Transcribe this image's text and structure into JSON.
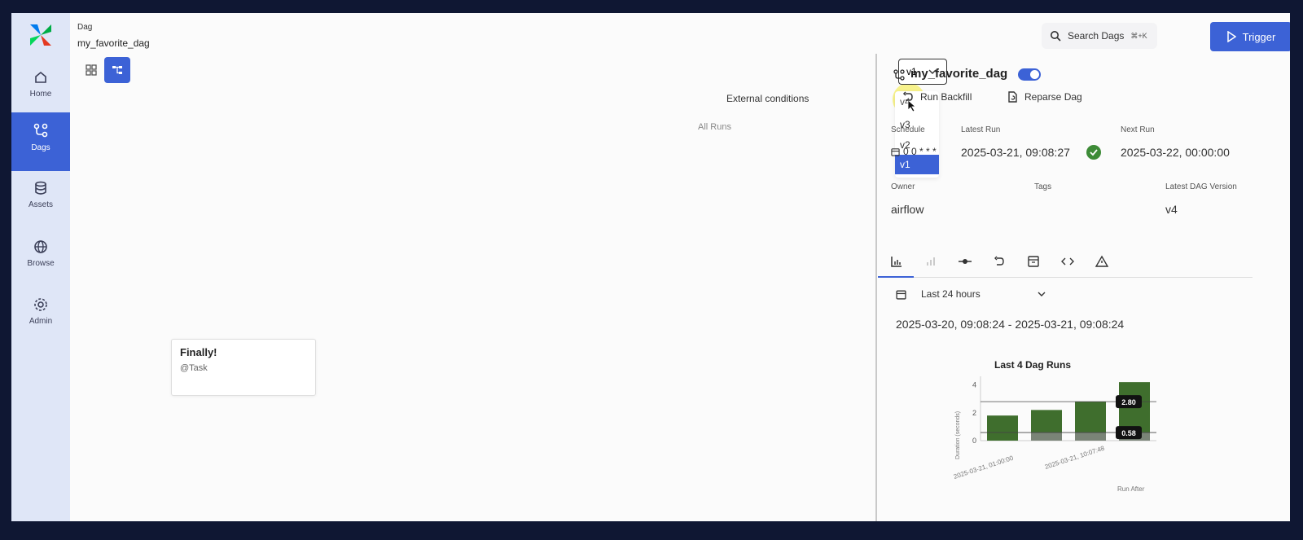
{
  "header": {
    "dag_label": "Dag",
    "dag_name": "my_favorite_dag",
    "search_label": "Search Dags",
    "search_shortcut": "⌘+K",
    "trigger_label": "Trigger"
  },
  "sidebar": {
    "items": [
      {
        "label": "Home",
        "icon": "home-icon",
        "active": false
      },
      {
        "label": "Dags",
        "icon": "dags-icon",
        "active": true
      },
      {
        "label": "Assets",
        "icon": "assets-icon",
        "active": false
      },
      {
        "label": "Browse",
        "icon": "browse-icon",
        "active": false
      },
      {
        "label": "Admin",
        "icon": "admin-icon",
        "active": false
      }
    ]
  },
  "graph": {
    "external_conditions": "External conditions",
    "all_runs": "All Runs",
    "version_selected": "v1",
    "version_options": [
      "v4",
      "v3",
      "v2",
      "v1"
    ],
    "node": {
      "title": "Finally!",
      "subtitle": "@Task"
    }
  },
  "details": {
    "dag_name": "my_favorite_dag",
    "run_backfill": "Run Backfill",
    "reparse_dag": "Reparse Dag",
    "schedule_label": "Schedule",
    "schedule_value": "0 0 * * *",
    "latest_run_label": "Latest Run",
    "latest_run_value": "2025-03-21, 09:08:27",
    "next_run_label": "Next Run",
    "next_run_value": "2025-03-22, 00:00:00",
    "owner_label": "Owner",
    "owner_value": "airflow",
    "tags_label": "Tags",
    "latest_version_label": "Latest DAG Version",
    "latest_version_value": "v4",
    "time_range": "Last 24 hours",
    "date_range": "2025-03-20, 09:08:24 - 2025-03-21, 09:08:24"
  },
  "colors": {
    "accent": "#3c62d6",
    "success": "#3d8b37",
    "bar_dark": "#3f6e2d",
    "bar_light": "#8a8a8a"
  },
  "chart_data": {
    "type": "bar",
    "title": "Last 4 Dag Runs",
    "ylabel": "Duration (seconds)",
    "xlabel": "Run After",
    "categories": [
      "2025-03-21, 01:00:00",
      "",
      "2025-03-21, 10:07:48",
      ""
    ],
    "series": [
      {
        "values": [
          1.8,
          2.2,
          2.8,
          4.2
        ]
      },
      {
        "values": [
          0.0,
          0.6,
          0.6,
          0.6
        ]
      }
    ],
    "reference_lines": [
      2.8,
      0.58
    ],
    "ylim": [
      0,
      4.5
    ],
    "yticks": [
      0,
      2,
      4
    ]
  }
}
